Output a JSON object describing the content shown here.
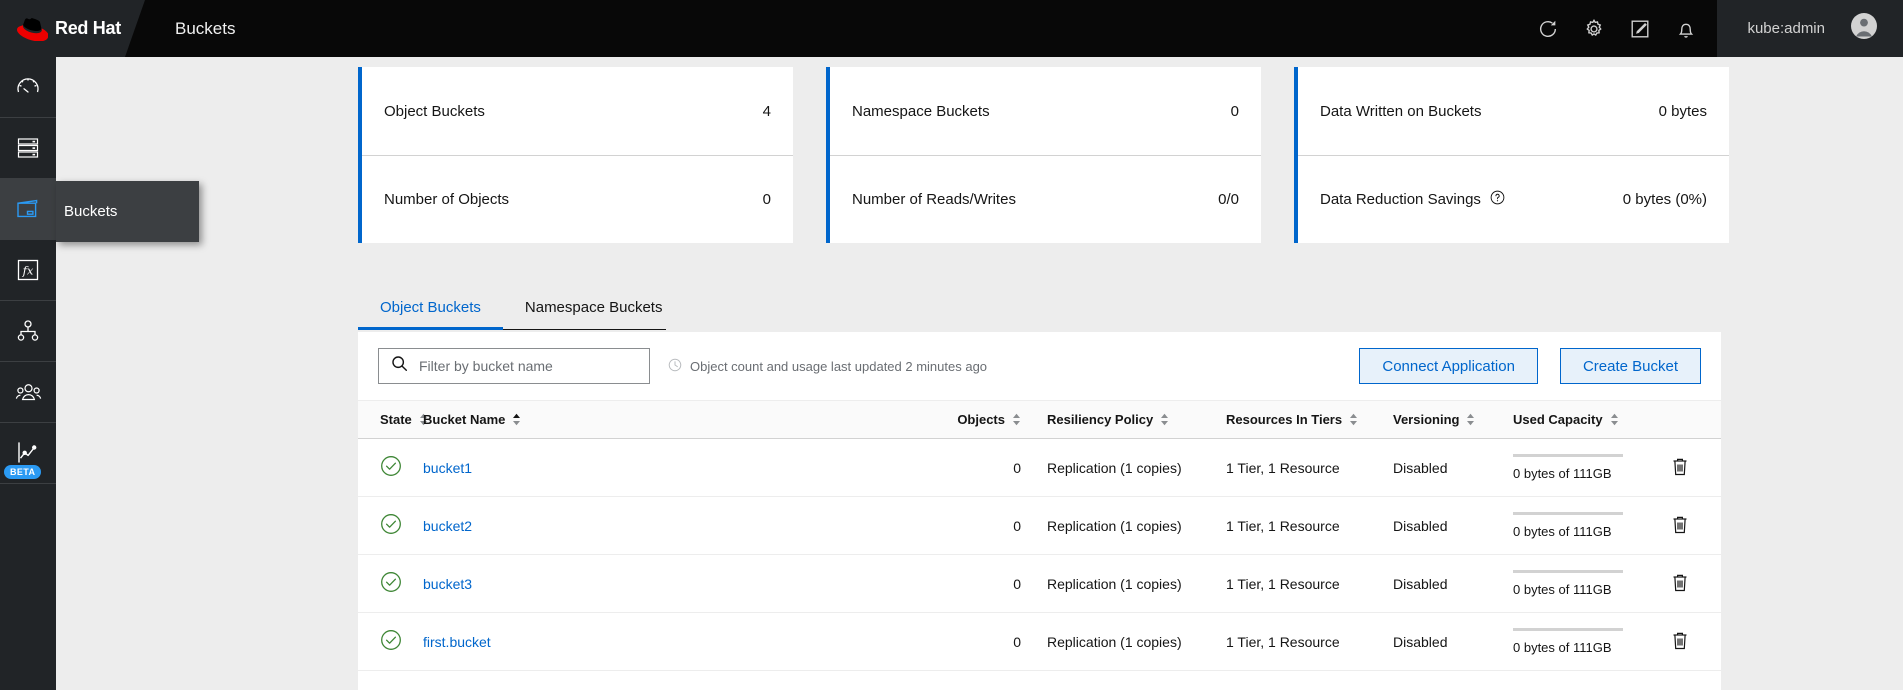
{
  "masthead": {
    "brand": "Red Hat",
    "title": "Buckets",
    "icons": [
      {
        "name": "refresh-icon",
        "label": "Refresh"
      },
      {
        "name": "gear-icon",
        "label": "Settings"
      },
      {
        "name": "edit-square-icon",
        "label": "Import YAML"
      },
      {
        "name": "bell-icon",
        "label": "Notifications"
      }
    ],
    "user": "kube:admin",
    "avatar_name": "user-avatar-icon"
  },
  "sidebar": {
    "items": [
      {
        "name": "sidebar-item-overview",
        "icon": "gauge-icon",
        "active": false,
        "beta": false
      },
      {
        "name": "sidebar-item-storage",
        "icon": "server-stack-icon",
        "active": false,
        "beta": false
      },
      {
        "name": "sidebar-item-buckets",
        "icon": "bucket-icon",
        "active": true,
        "beta": false
      },
      {
        "name": "sidebar-item-functions",
        "icon": "fx-icon",
        "active": false,
        "beta": false
      },
      {
        "name": "sidebar-item-topology",
        "icon": "hierarchy-icon",
        "active": false,
        "beta": false
      },
      {
        "name": "sidebar-item-accounts",
        "icon": "users-icon",
        "active": false,
        "beta": false
      },
      {
        "name": "sidebar-item-analytics",
        "icon": "line-chart-icon",
        "active": false,
        "beta": true
      }
    ],
    "flyout_label": "Buckets",
    "beta_label": "BETA"
  },
  "cards": [
    {
      "name": "object-buckets-card",
      "rows": [
        {
          "label": "Object Buckets",
          "value": "4",
          "help": false
        },
        {
          "label": "Number of Objects",
          "value": "0",
          "help": false
        }
      ]
    },
    {
      "name": "namespace-buckets-card",
      "rows": [
        {
          "label": "Namespace Buckets",
          "value": "0",
          "help": false
        },
        {
          "label": "Number of Reads/Writes",
          "value": "0/0",
          "help": false
        }
      ]
    },
    {
      "name": "data-written-card",
      "rows": [
        {
          "label": "Data Written on Buckets",
          "value": "0 bytes",
          "help": false
        },
        {
          "label": "Data Reduction Savings",
          "value": "0 bytes (0%)",
          "help": true
        }
      ]
    }
  ],
  "tabs": [
    {
      "label": "Object Buckets",
      "name": "tab-object-buckets",
      "active": true
    },
    {
      "label": "Namespace Buckets",
      "name": "tab-namespace-buckets",
      "active": false
    }
  ],
  "toolbar": {
    "search_placeholder": "Filter by bucket name",
    "search_value": "",
    "updated_note": "Object count and usage last updated 2 minutes ago",
    "connect_application_label": "Connect Application",
    "create_bucket_label": "Create Bucket"
  },
  "table": {
    "columns": [
      {
        "label": "State",
        "sortable": true,
        "sorted": "none"
      },
      {
        "label": "Bucket Name",
        "sortable": true,
        "sorted": "asc"
      },
      {
        "label": "Objects",
        "sortable": true,
        "sorted": "none"
      },
      {
        "label": "Resiliency Policy",
        "sortable": true,
        "sorted": "none"
      },
      {
        "label": "Resources In Tiers",
        "sortable": true,
        "sorted": "none"
      },
      {
        "label": "Versioning",
        "sortable": true,
        "sorted": "none"
      },
      {
        "label": "Used Capacity",
        "sortable": true,
        "sorted": "none"
      }
    ],
    "rows": [
      {
        "state": "healthy",
        "name": "bucket1",
        "objects": "0",
        "resiliency": "Replication (1 copies)",
        "tiers": "1 Tier, 1 Resource",
        "versioning": "Disabled",
        "capacity_text": "0 bytes of 111GB",
        "capacity_percent": 0
      },
      {
        "state": "healthy",
        "name": "bucket2",
        "objects": "0",
        "resiliency": "Replication (1 copies)",
        "tiers": "1 Tier, 1 Resource",
        "versioning": "Disabled",
        "capacity_text": "0 bytes of 111GB",
        "capacity_percent": 0
      },
      {
        "state": "healthy",
        "name": "bucket3",
        "objects": "0",
        "resiliency": "Replication (1 copies)",
        "tiers": "1 Tier, 1 Resource",
        "versioning": "Disabled",
        "capacity_text": "0 bytes of 111GB",
        "capacity_percent": 0
      },
      {
        "state": "healthy",
        "name": "first.bucket",
        "objects": "0",
        "resiliency": "Replication (1 copies)",
        "tiers": "1 Tier, 1 Resource",
        "versioning": "Disabled",
        "capacity_text": "0 bytes of 111GB",
        "capacity_percent": 0
      }
    ],
    "delete_icon_name": "delete-bucket-icon",
    "status_icon_name": "status-healthy-icon"
  },
  "colors": {
    "accent_blue": "#06c",
    "masthead_bg": "#080808",
    "brand_bg": "#212427",
    "page_bg": "#ededed",
    "status_green": "#3e8635",
    "beta_badge": "#2b9af3",
    "red_hat_red": "#e00"
  }
}
